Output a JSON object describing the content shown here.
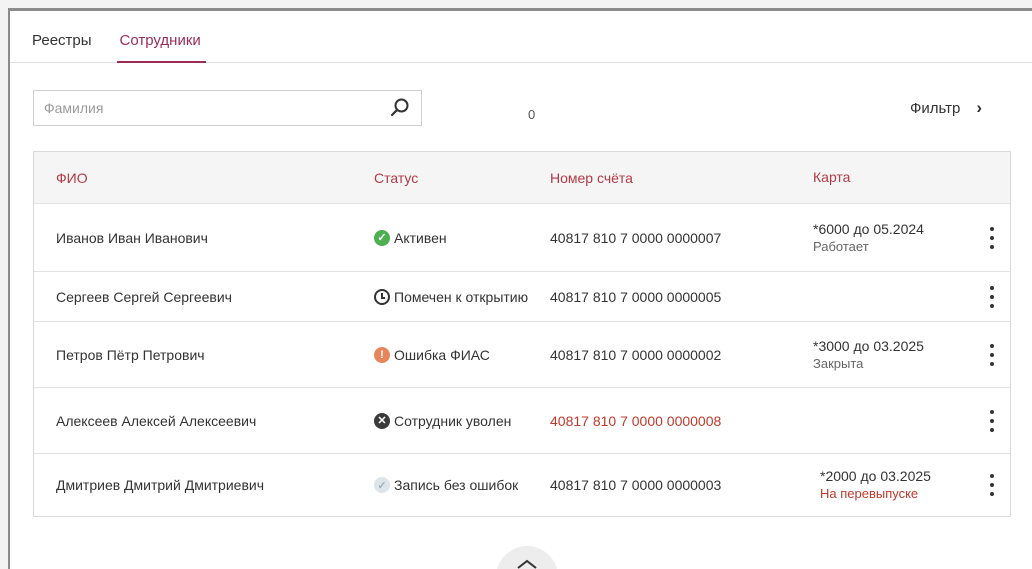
{
  "tabs": [
    {
      "label": "Реестры",
      "active": false
    },
    {
      "label": "Сотрудники",
      "active": true
    }
  ],
  "search": {
    "placeholder": "Фамилия",
    "icon": "search-icon"
  },
  "count": "0",
  "filter": {
    "label": "Фильтр",
    "icon": "chevron-right-icon"
  },
  "table": {
    "headers": [
      "ФИО",
      "Статус",
      "Номер счёта",
      "Карта"
    ],
    "rows": [
      {
        "name": "Иванов Иван Иванович",
        "status": "Активен",
        "status_icon": "check-circle-icon",
        "account": "40817 810 7 0000 0000007",
        "account_red": false,
        "card": "*6000 до 05.2024",
        "card_status": "Работает",
        "card_status_red": false
      },
      {
        "name": "Сергеев Сергей Сергеевич",
        "status": "Помечен к открытию",
        "status_icon": "clock-icon",
        "account": "40817 810 7 0000 0000005",
        "account_red": false,
        "card": "",
        "card_status": "",
        "card_status_red": false
      },
      {
        "name": "Петров Пётр Петрович",
        "status": "Ошибка ФИАС",
        "status_icon": "error-icon",
        "account": "40817 810 7 0000 0000002",
        "account_red": false,
        "card": "*3000 до 03.2025",
        "card_status": "Закрыта",
        "card_status_red": false
      },
      {
        "name": "Алексеев Алексей Алексеевич",
        "status": "Сотрудник уволен",
        "status_icon": "x-circle-icon",
        "account": "40817 810 7 0000 0000008",
        "account_red": true,
        "card": "",
        "card_status": "",
        "card_status_red": false
      },
      {
        "name": "Дмитриев Дмитрий Дмитриевич",
        "status": "Запись без ошибок",
        "status_icon": "check-light-icon",
        "account": "40817 810 7 0000 0000003",
        "account_red": false,
        "card": "*2000 до 03.2025",
        "card_status": "На перевыпуске",
        "card_status_red": true
      }
    ]
  },
  "colors": {
    "accent": "#9b2c5a",
    "header_text": "#b23a48",
    "error_text": "#c0392b",
    "active": "#4caf50",
    "warning": "#e8855a"
  }
}
